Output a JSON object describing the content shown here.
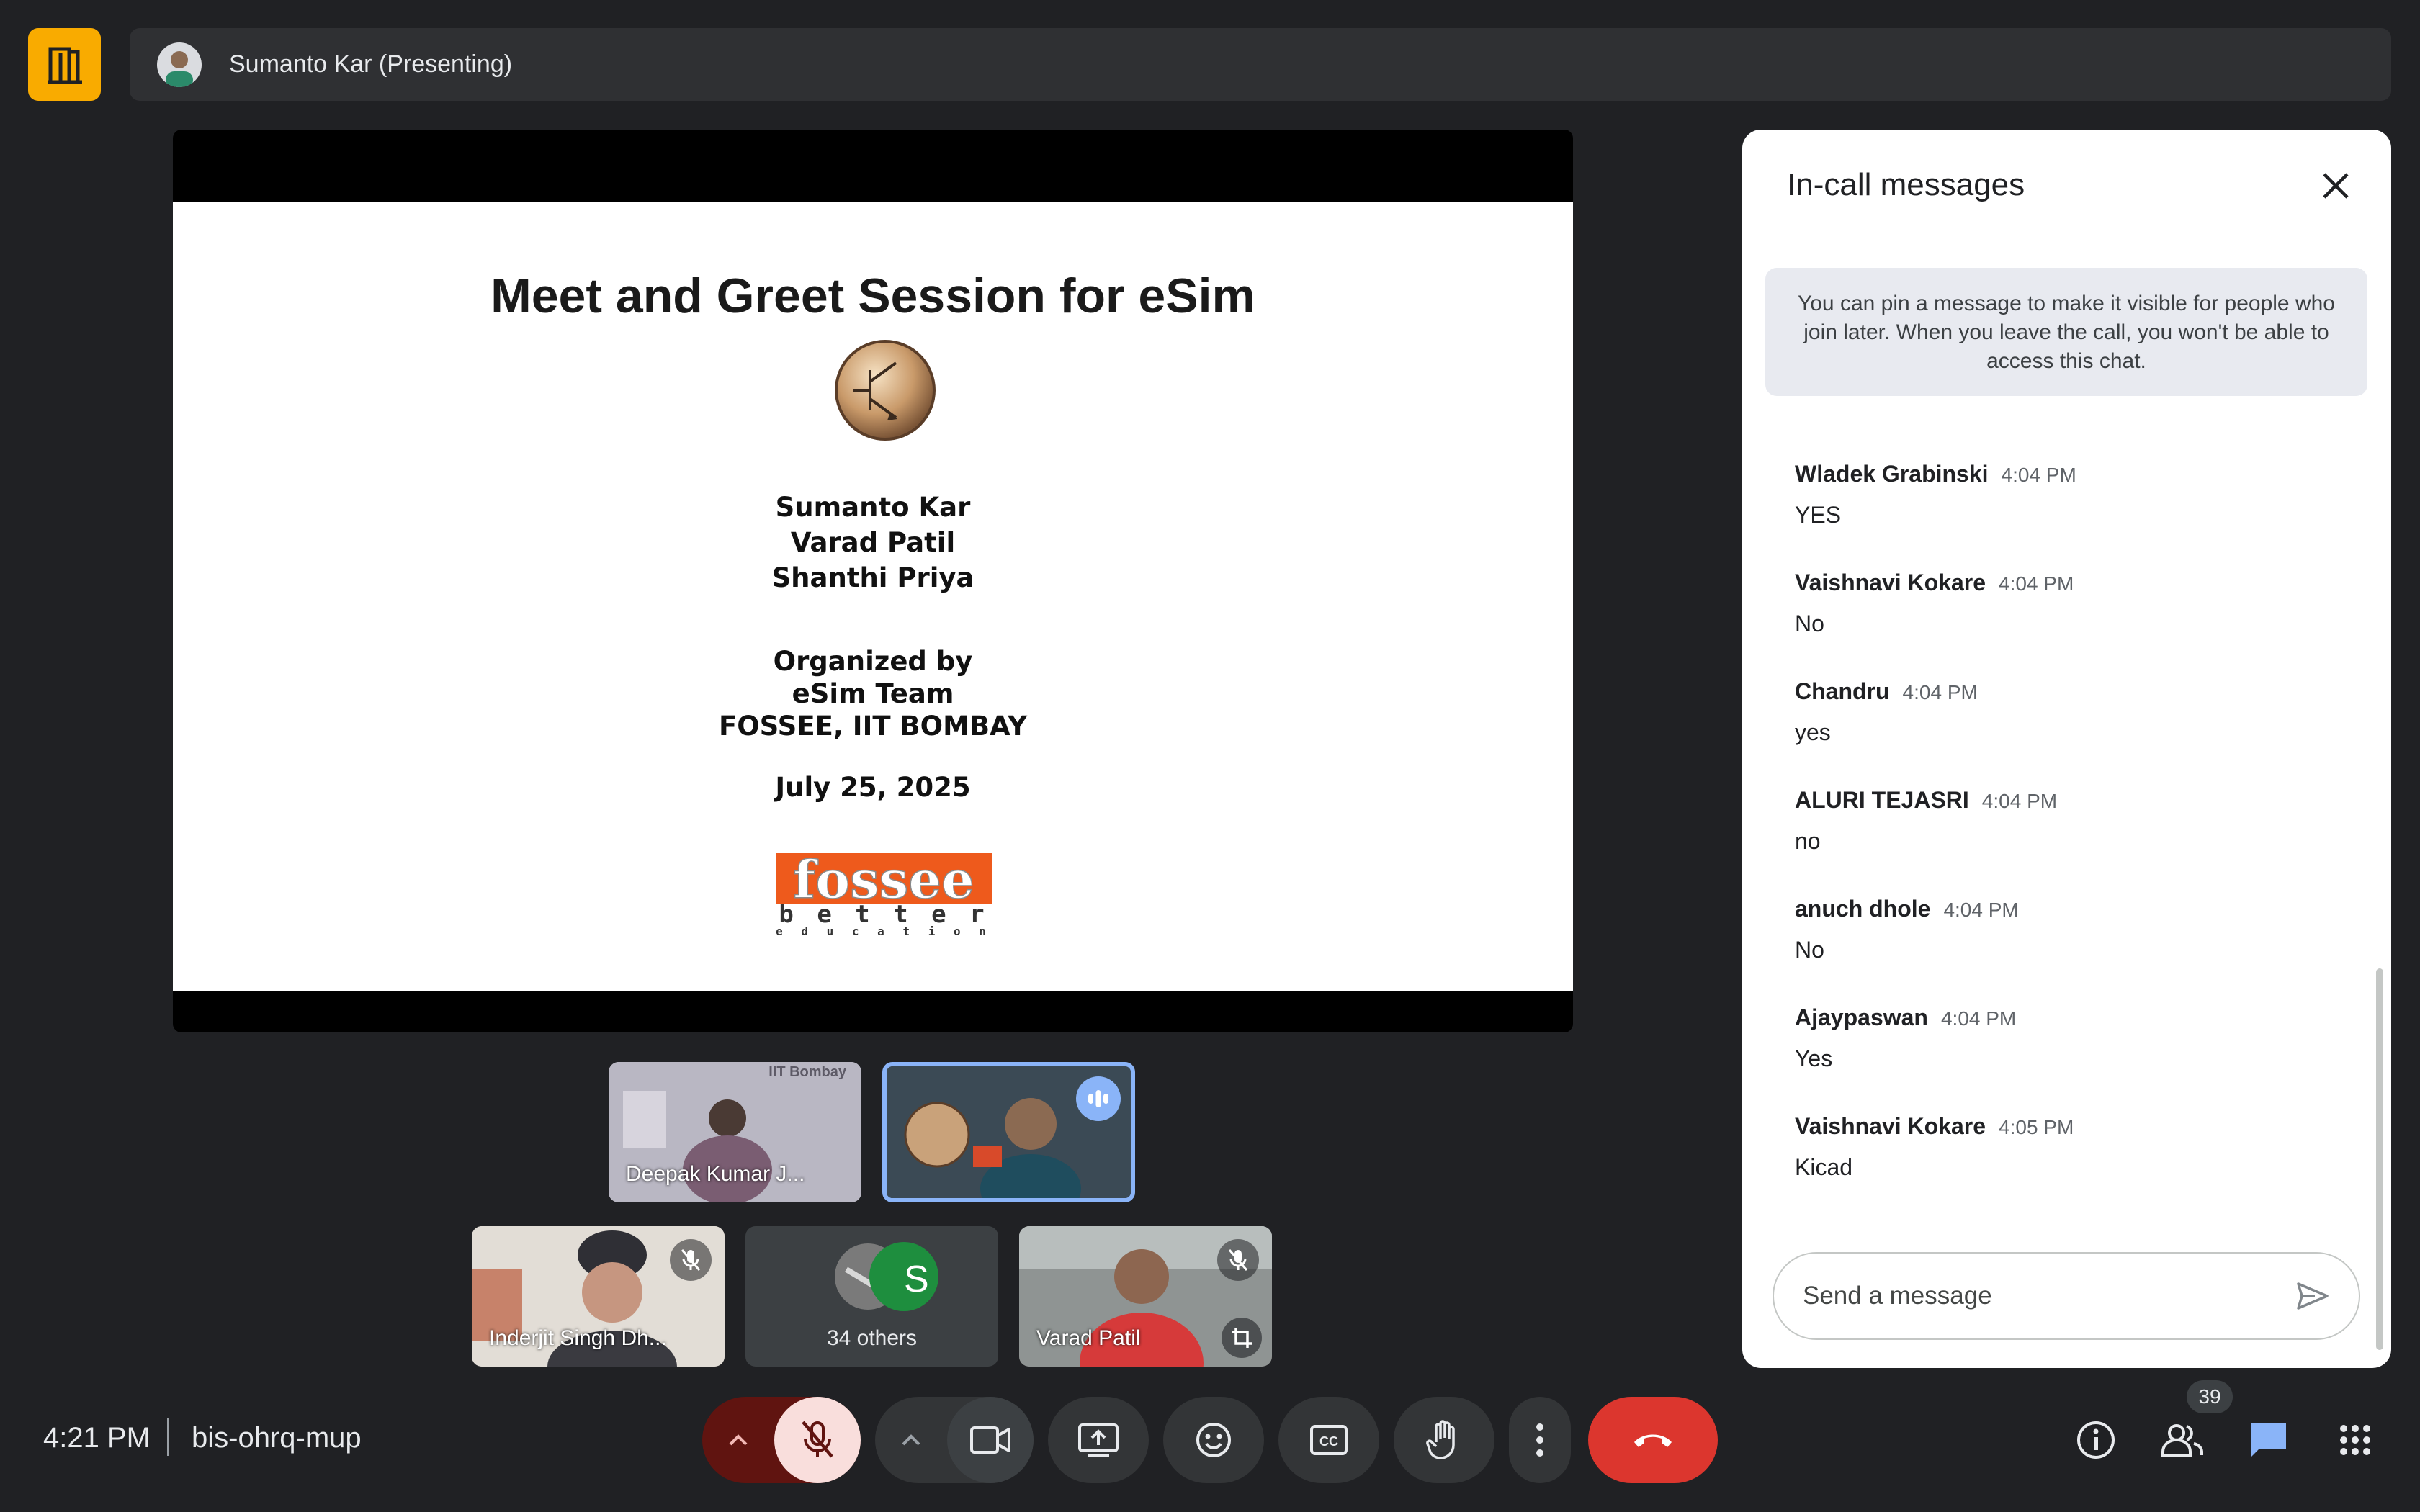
{
  "header": {
    "presenter_label": "Sumanto Kar (Presenting)"
  },
  "slide": {
    "title": "Meet and Greet Session for eSim",
    "presenters": [
      "Sumanto Kar",
      "Varad Patil",
      "Shanthi Priya"
    ],
    "organized_lines": [
      "Organized by",
      "eSim Team",
      "FOSSEE, IIT BOMBAY"
    ],
    "date": "July 25, 2025",
    "logo_word": "fossee",
    "logo_tagline": "b e t t e r",
    "logo_sub": "e d u c a t i o n"
  },
  "participants": {
    "deepak": {
      "name": "Deepak Kumar J...",
      "watermark": "IIT Bombay"
    },
    "inderjit": {
      "name": "Inderjit Singh Dh..."
    },
    "others": {
      "initial": "S",
      "label": "34 others"
    },
    "varad": {
      "name": "Varad Patil"
    }
  },
  "chat": {
    "title": "In-call messages",
    "notice": "You can pin a message to make it visible for people who join later. When you leave the call, you won't be able to access this chat.",
    "messages": [
      {
        "sender": "Wladek Grabinski",
        "time": "4:04 PM",
        "text": "YES"
      },
      {
        "sender": "Vaishnavi Kokare",
        "time": "4:04 PM",
        "text": "No"
      },
      {
        "sender": "Chandru",
        "time": "4:04 PM",
        "text": "yes"
      },
      {
        "sender": "ALURI TEJASRI",
        "time": "4:04 PM",
        "text": "no"
      },
      {
        "sender": "anuch dhole",
        "time": "4:04 PM",
        "text": "No"
      },
      {
        "sender": "Ajaypaswan",
        "time": "4:04 PM",
        "text": "Yes"
      },
      {
        "sender": "Vaishnavi Kokare",
        "time": "4:05 PM",
        "text": "Kicad"
      }
    ],
    "input_placeholder": "Send a message"
  },
  "footer": {
    "time": "4:21 PM",
    "meeting_code": "bis-ohrq-mup",
    "people_count": "39"
  },
  "colors": {
    "background": "#202124",
    "logo_yellow": "#f9ab00",
    "leave_red": "#dc362e",
    "mic_off_bg": "#f9dedc",
    "chat_active_blue": "#8ab4f8"
  },
  "icons": [
    "door-logo-icon",
    "mic-off-icon",
    "chevron-up-icon",
    "camera-icon",
    "present-icon",
    "emoji-icon",
    "captions-icon",
    "hand-icon",
    "more-vert-icon",
    "call-end-icon",
    "info-icon",
    "people-icon",
    "chat-icon",
    "apps-icon",
    "close-icon",
    "send-icon",
    "crop-icon",
    "speaking-icon"
  ]
}
